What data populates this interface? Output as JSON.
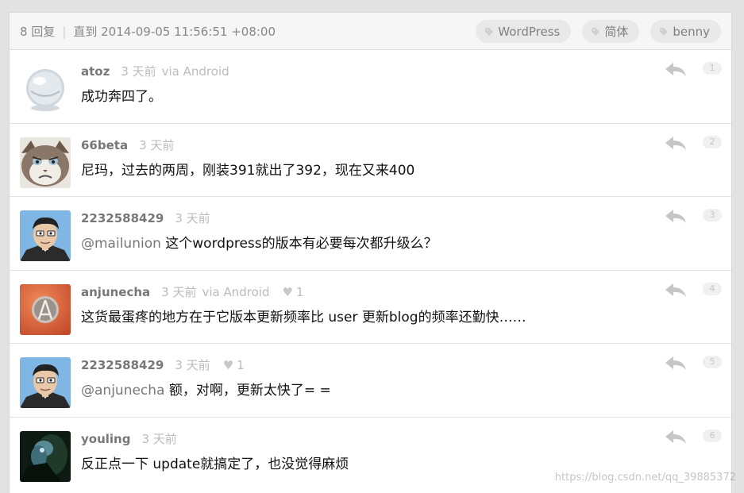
{
  "header": {
    "reply_count": "8 回复",
    "separator": "|",
    "until": "直到 2014-09-05 11:56:51 +08:00",
    "tags": [
      {
        "label": "WordPress",
        "icon": "tag-icon"
      },
      {
        "label": "简体",
        "icon": "tag-icon"
      },
      {
        "label": "benny",
        "icon": "tag-icon"
      }
    ]
  },
  "replies": [
    {
      "author": "atoz",
      "ago": "3 天前",
      "via": "via Android",
      "thanks": "",
      "mention": "",
      "content": "成功奔四了。",
      "floor": "1",
      "avatar_icon": "crystal-ball-avatar"
    },
    {
      "author": "66beta",
      "ago": "3 天前",
      "via": "",
      "thanks": "",
      "mention": "",
      "content": "尼玛，过去的两周，刚装391就出了392，现在又来400",
      "floor": "2",
      "avatar_icon": "grumpy-cat-avatar"
    },
    {
      "author": "2232588429",
      "ago": "3 天前",
      "via": "",
      "thanks": "",
      "mention": "@mailunion",
      "content": " 这个wordpress的版本有必要每次都升级么？",
      "floor": "3",
      "avatar_icon": "cartoon-man-avatar"
    },
    {
      "author": "anjunecha",
      "ago": "3 天前",
      "via": "via Android",
      "thanks": "1",
      "mention": "",
      "content": "这货最蛋疼的地方在于它版本更新频率比 user 更新blog的频率还勤快……",
      "floor": "4",
      "avatar_icon": "logo-avatar"
    },
    {
      "author": "2232588429",
      "ago": "3 天前",
      "via": "",
      "thanks": "1",
      "mention": "@anjunecha",
      "content": " 额，对啊，更新太快了= =",
      "floor": "5",
      "avatar_icon": "cartoon-man-avatar"
    },
    {
      "author": "youling",
      "ago": "3 天前",
      "via": "",
      "thanks": "",
      "mention": "",
      "content": "反正点一下 update就搞定了，也没觉得麻烦",
      "floor": "6",
      "avatar_icon": "dark-figure-avatar"
    }
  ],
  "watermark": "https://blog.csdn.net/qq_39885372",
  "colors": {
    "author": "#777777",
    "muted": "#bbbbbb",
    "tag_bg": "#e9e9e9",
    "page_bg": "#e2e2e2"
  }
}
